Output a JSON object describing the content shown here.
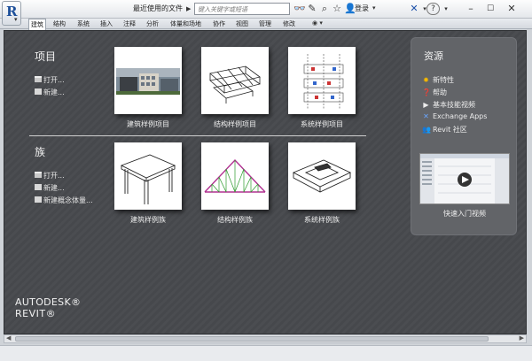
{
  "titlebar": {
    "app_letter": "R",
    "recent_label": "最近使用的文件",
    "search_placeholder": "键入关键字或短语",
    "login": "登录",
    "help": "?"
  },
  "tabs": [
    "建筑",
    "结构",
    "系统",
    "插入",
    "注释",
    "分析",
    "体量和场地",
    "协作",
    "视图",
    "管理",
    "修改"
  ],
  "projects": {
    "title": "项目",
    "links": [
      "打开...",
      "新建..."
    ],
    "cards": [
      "建筑样例项目",
      "结构样例项目",
      "系统样例项目"
    ]
  },
  "families": {
    "title": "族",
    "links": [
      "打开...",
      "新建...",
      "新建概念体量..."
    ],
    "cards": [
      "建筑样例族",
      "结构样例族",
      "系统样例族"
    ]
  },
  "resources": {
    "title": "资源",
    "links": [
      "新特性",
      "帮助",
      "基本技能视频",
      "Exchange Apps",
      "Revit 社区"
    ],
    "video_label": "快速入门视频"
  },
  "brand": {
    "line1": "AUTODESK®",
    "line2": "REVIT®"
  }
}
